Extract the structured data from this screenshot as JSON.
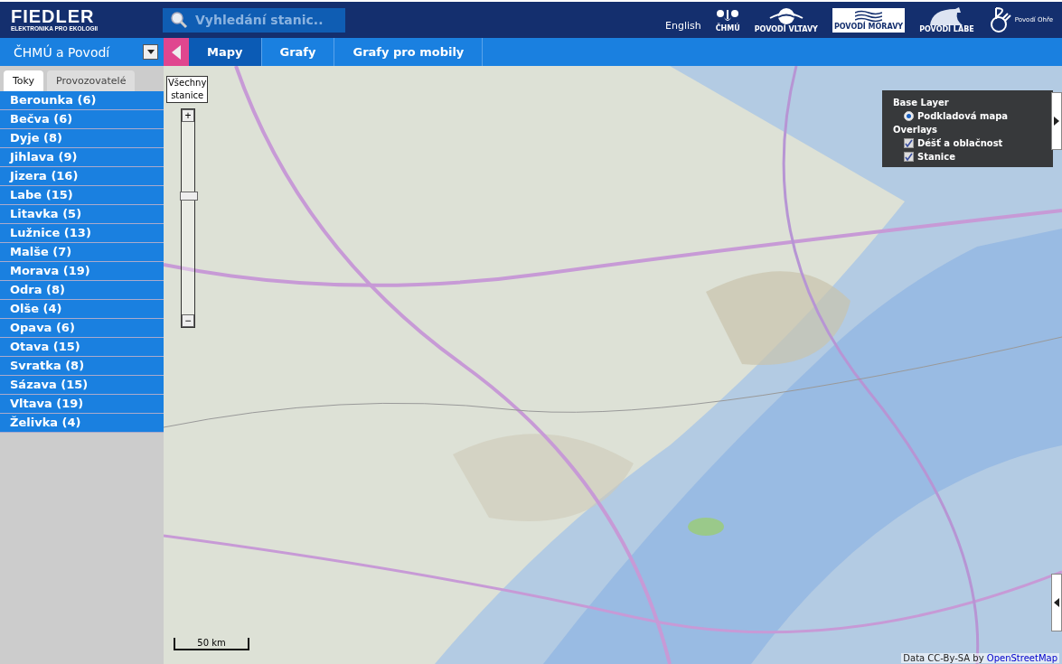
{
  "header": {
    "logo": {
      "title": "FIEDLER",
      "subtitle": "ELEKTRONIKA PRO EKOLOGII"
    },
    "search": {
      "placeholder": "Vyhledání stanic.."
    },
    "language_link": "English",
    "partner_logos": [
      {
        "kind": "chmu",
        "label": "ČHMÚ"
      },
      {
        "kind": "vltava",
        "label": "POVODÍ VLTAVY"
      },
      {
        "kind": "morava",
        "label": "POVODÍ MORAVY"
      },
      {
        "kind": "labe",
        "label": "POVODÍ LABE"
      },
      {
        "kind": "ohre",
        "label": "Povodí Ohře"
      }
    ]
  },
  "navbar": {
    "dropdown": "ČHMÚ a Povodí",
    "tabs": [
      {
        "label": "Mapy",
        "selected": true
      },
      {
        "label": "Grafy",
        "selected": false
      },
      {
        "label": "Grafy pro mobily",
        "selected": false
      }
    ]
  },
  "sidebar": {
    "tabs": [
      {
        "label": "Toky",
        "selected": true
      },
      {
        "label": "Provozovatelé",
        "selected": false
      }
    ],
    "items": [
      "Berounka (6)",
      "Bečva (6)",
      "Dyje (8)",
      "Jihlava (9)",
      "Jizera (16)",
      "Labe (15)",
      "Litavka (5)",
      "Lužnice (13)",
      "Malše (7)",
      "Morava (19)",
      "Odra (8)",
      "Olše (4)",
      "Opava (6)",
      "Otava (15)",
      "Svratka (8)",
      "Sázava (15)",
      "Vltava (19)",
      "Želivka (4)"
    ]
  },
  "map": {
    "all_stations_button": "Všechny stanice",
    "zoom": {
      "zoom_in": "+",
      "zoom_out": "−",
      "level": 0.62
    },
    "layers": {
      "base_title": "Base Layer",
      "base_layers": [
        {
          "label": "Podkladová mapa",
          "selected": true
        }
      ],
      "overlays_title": "Overlays",
      "overlays": [
        {
          "label": "Déšť a oblačnost",
          "checked": true
        },
        {
          "label": "Stanice",
          "checked": true
        }
      ]
    },
    "scale": "50 km",
    "attribution": "Data CC-By-SA by",
    "attribution_link": "OpenStreetMap"
  }
}
